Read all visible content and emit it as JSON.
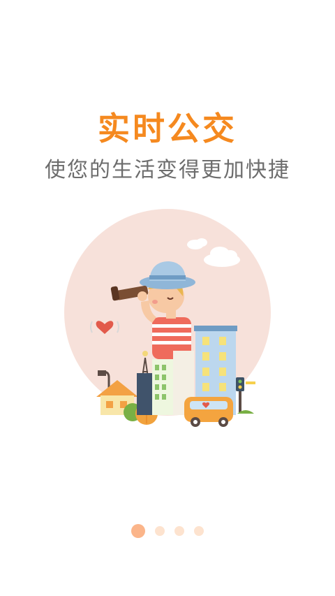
{
  "onboarding": {
    "title": "实时公交",
    "subtitle": "使您的生活变得更加快捷",
    "illustration": "city-bus-boy-with-telescope",
    "pages": 4,
    "current_page": 1
  },
  "colors": {
    "accent": "#f5891f",
    "subtitle": "#6d6d6d",
    "circle_bg": "#f7e1da",
    "dot_active": "#fbb58a",
    "dot_inactive": "#fde3cf"
  }
}
